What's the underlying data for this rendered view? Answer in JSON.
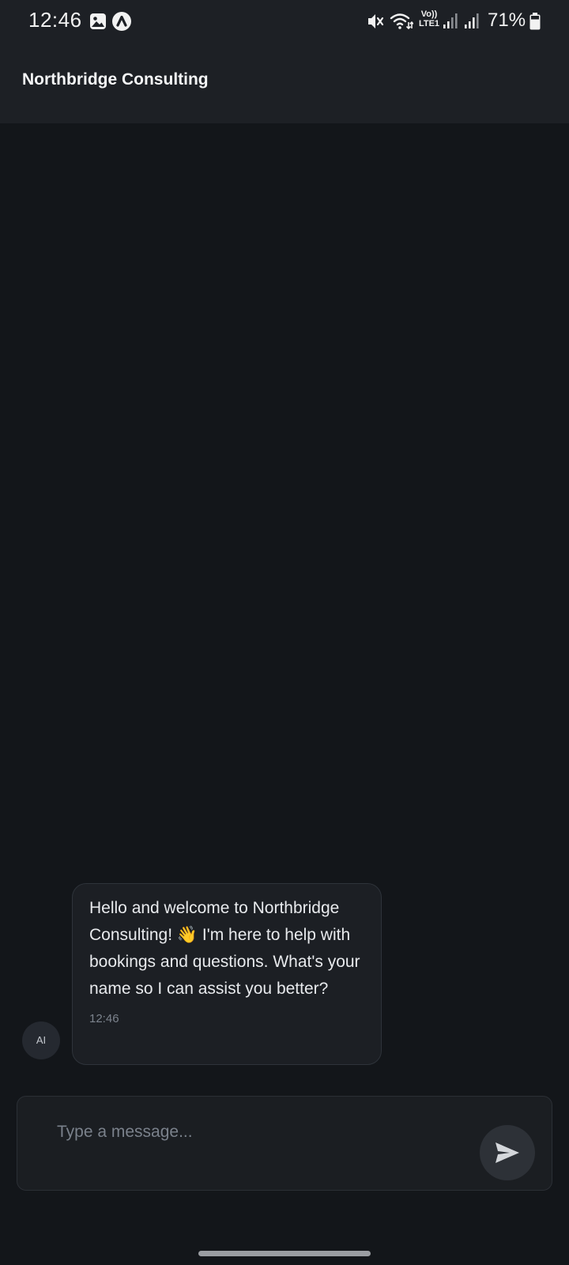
{
  "status_bar": {
    "time": "12:46",
    "network_label_top": "Vo))",
    "network_label_bottom": "LTE1",
    "battery_percent": "71%",
    "icons": [
      "gallery-icon",
      "app-badge-icon",
      "mute-icon",
      "wifi-icon",
      "signal-icon",
      "signal-icon",
      "battery-icon"
    ]
  },
  "header": {
    "title": "Northbridge Consulting"
  },
  "chat": {
    "messages": [
      {
        "sender_avatar": "AI",
        "text": "Hello and welcome to Northbridge Consulting! 👋 I'm here to help with bookings and questions. What's your name so I can assist you better?",
        "time": "12:46"
      }
    ]
  },
  "composer": {
    "placeholder": "Type a message...",
    "value": "",
    "send_icon": "send-icon"
  },
  "colors": {
    "background": "#13161a",
    "header": "#1d2025",
    "bubble": "#1c1f24",
    "send_button": "#2d3137"
  }
}
